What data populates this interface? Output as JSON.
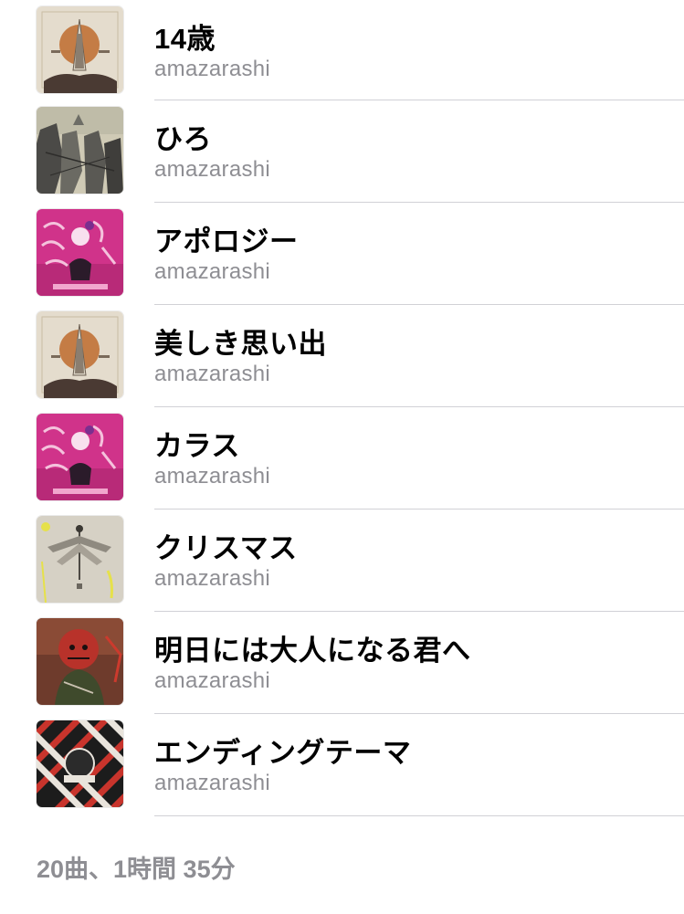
{
  "tracks": [
    {
      "title": "14歳",
      "artist": "amazarashi",
      "artwork": "album-beige-sun"
    },
    {
      "title": "ひろ",
      "artist": "amazarashi",
      "artwork": "album-grey-figures"
    },
    {
      "title": "アポロジー",
      "artist": "amazarashi",
      "artwork": "album-magenta"
    },
    {
      "title": "美しき思い出",
      "artist": "amazarashi",
      "artwork": "album-beige-sun"
    },
    {
      "title": "カラス",
      "artist": "amazarashi",
      "artwork": "album-magenta"
    },
    {
      "title": "クリスマス",
      "artist": "amazarashi",
      "artwork": "album-grey-wings"
    },
    {
      "title": "明日には大人になる君へ",
      "artist": "amazarashi",
      "artwork": "album-red-mask"
    },
    {
      "title": "エンディングテーマ",
      "artist": "amazarashi",
      "artwork": "album-red-stripes"
    }
  ],
  "footer": {
    "summary": "20曲、1時間 35分"
  },
  "colors": {
    "title": "#000000",
    "secondary": "#8e8e93",
    "separator": "#d1d1d6"
  }
}
